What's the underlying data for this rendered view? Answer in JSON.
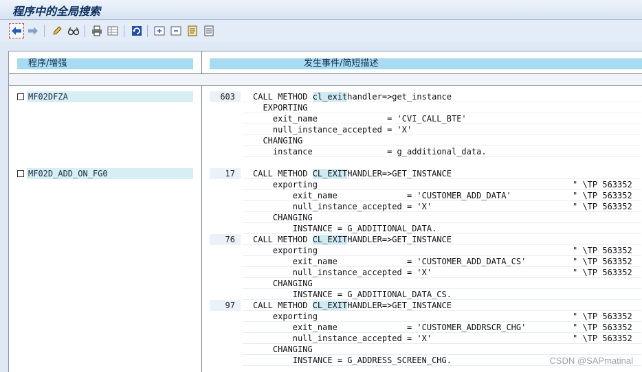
{
  "window": {
    "title": "程序中的全局搜索"
  },
  "toolbar": {
    "icons": [
      "back-arrow-icon",
      "forward-arrow-icon",
      "pencil-icon",
      "glasses-icon",
      "printer-icon",
      "table-icon",
      "refresh-icon",
      "expand-icon",
      "collapse-icon",
      "document-icon",
      "document-lines-icon"
    ]
  },
  "table": {
    "col_program": "程序/增强",
    "col_event": "发生事件/简短描述"
  },
  "results": [
    {
      "program": "MF02DFZA",
      "hits": [
        {
          "line_no": "603",
          "lines": [
            {
              "pre": "CALL METHOD ",
              "hl": "cl_exit",
              "post": "handler=>get_instance",
              "comment": ""
            },
            {
              "pre": "  EXPORTING",
              "hl": "",
              "post": "",
              "comment": ""
            },
            {
              "pre": "    exit_name              = 'CVI_CALL_BTE'",
              "hl": "",
              "post": "",
              "comment": ""
            },
            {
              "pre": "    null_instance_accepted = 'X'",
              "hl": "",
              "post": "",
              "comment": ""
            },
            {
              "pre": "  CHANGING",
              "hl": "",
              "post": "",
              "comment": ""
            },
            {
              "pre": "    instance               = g_additional_data.",
              "hl": "",
              "post": "",
              "comment": ""
            }
          ]
        }
      ]
    },
    {
      "program": "MF02D_ADD_ON_FG0",
      "hits": [
        {
          "line_no": "17",
          "lines": [
            {
              "pre": "CALL METHOD ",
              "hl": "CL_EXIT",
              "post": "HANDLER=>GET_INSTANCE",
              "comment": ""
            },
            {
              "pre": "    exporting",
              "hl": "",
              "post": "",
              "comment": "\" \\TP 563352"
            },
            {
              "pre": "        exit_name              = 'CUSTOMER_ADD_DATA'",
              "hl": "",
              "post": "",
              "comment": "\" \\TP 563352"
            },
            {
              "pre": "        null_instance_accepted = 'X'",
              "hl": "",
              "post": "",
              "comment": "\" \\TP 563352"
            },
            {
              "pre": "    CHANGING",
              "hl": "",
              "post": "",
              "comment": ""
            },
            {
              "pre": "        INSTANCE = G_ADDITIONAL_DATA.",
              "hl": "",
              "post": "",
              "comment": ""
            }
          ]
        },
        {
          "line_no": "76",
          "lines": [
            {
              "pre": "CALL METHOD ",
              "hl": "CL_EXIT",
              "post": "HANDLER=>GET_INSTANCE",
              "comment": ""
            },
            {
              "pre": "    exporting",
              "hl": "",
              "post": "",
              "comment": "\" \\TP 563352"
            },
            {
              "pre": "        exit_name              = 'CUSTOMER_ADD_DATA_CS'",
              "hl": "",
              "post": "",
              "comment": "\" \\TP 563352"
            },
            {
              "pre": "        null_instance_accepted = 'X'",
              "hl": "",
              "post": "",
              "comment": "\" \\TP 563352"
            },
            {
              "pre": "    CHANGING",
              "hl": "",
              "post": "",
              "comment": ""
            },
            {
              "pre": "        INSTANCE = G_ADDITIONAL_DATA_CS.",
              "hl": "",
              "post": "",
              "comment": ""
            }
          ]
        },
        {
          "line_no": "97",
          "lines": [
            {
              "pre": "CALL METHOD ",
              "hl": "CL_EXIT",
              "post": "HANDLER=>GET_INSTANCE",
              "comment": ""
            },
            {
              "pre": "    exporting",
              "hl": "",
              "post": "",
              "comment": "\" \\TP 563352"
            },
            {
              "pre": "        exit_name              = 'CUSTOMER_ADDRSCR_CHG'",
              "hl": "",
              "post": "",
              "comment": "\" \\TP 563352"
            },
            {
              "pre": "        null_instance_accepted = 'X'",
              "hl": "",
              "post": "",
              "comment": "\" \\TP 563352"
            },
            {
              "pre": "    CHANGING",
              "hl": "",
              "post": "",
              "comment": ""
            },
            {
              "pre": "        INSTANCE = G_ADDRESS_SCREEN_CHG.",
              "hl": "",
              "post": "",
              "comment": ""
            }
          ]
        }
      ]
    }
  ],
  "watermark": "CSDN @SAPmatinal"
}
